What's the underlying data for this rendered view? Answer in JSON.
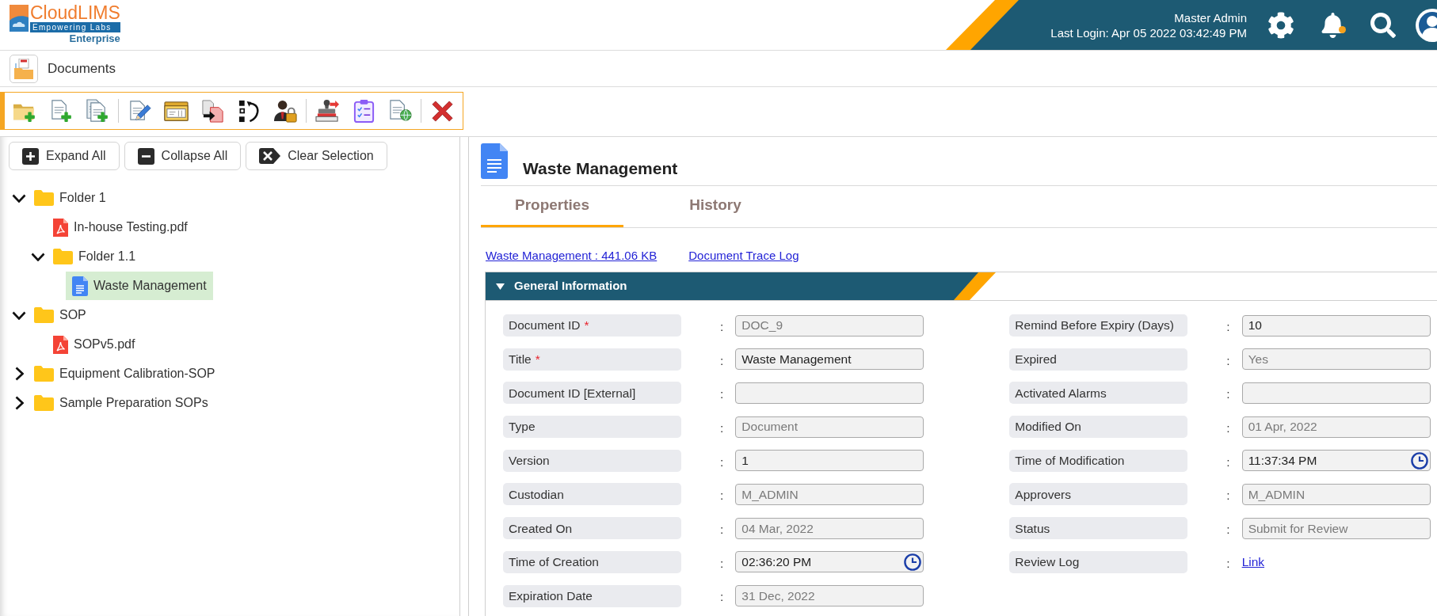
{
  "logo": {
    "name": "CloudLIMS",
    "tagline": "Empowering Labs",
    "edition": "Enterprise"
  },
  "header": {
    "user_name": "Master Admin",
    "last_login": "Last Login: Apr 05 2022 03:42:49 PM",
    "unread_notifications": true
  },
  "page": {
    "title": "Documents"
  },
  "tree_actions": [
    {
      "kind": "expand",
      "label": "Expand All"
    },
    {
      "kind": "collapse",
      "label": "Collapse All"
    },
    {
      "kind": "clear",
      "label": "Clear Selection"
    }
  ],
  "tree": [
    {
      "kind": "folder",
      "label": "Folder 1",
      "expanded": true,
      "selected": false,
      "children": [
        {
          "kind": "pdf",
          "label": "In-house Testing.pdf",
          "selected": false
        },
        {
          "kind": "folder",
          "label": "Folder 1.1",
          "expanded": true,
          "selected": false,
          "children": [
            {
              "kind": "doc",
              "label": "Waste Management",
              "selected": true
            }
          ]
        }
      ]
    },
    {
      "kind": "folder",
      "label": "SOP",
      "expanded": true,
      "selected": false,
      "children": [
        {
          "kind": "pdf",
          "label": "SOPv5.pdf",
          "selected": false
        }
      ]
    },
    {
      "kind": "folder",
      "label": "Equipment Calibration-SOP",
      "expanded": false,
      "selected": false
    },
    {
      "kind": "folder",
      "label": "Sample Preparation SOPs",
      "expanded": false,
      "selected": false
    }
  ],
  "document": {
    "title": "Waste Management"
  },
  "tabs": [
    {
      "label": "Properties",
      "selected": true
    },
    {
      "label": "History",
      "selected": false
    }
  ],
  "links": [
    "Waste Management : 441.06 KB",
    "Document Trace Log"
  ],
  "section": {
    "title": "General Information",
    "expanded": true,
    "columns": [
      [
        {
          "label": "Document ID",
          "required_mark": "*",
          "separator": ":",
          "kind": "text",
          "value": "DOC_9",
          "disabled": true
        },
        {
          "label": "Title",
          "required_mark": "*",
          "separator": ":",
          "kind": "text",
          "value": "Waste Management",
          "disabled": false
        },
        {
          "label": "Document ID [External]",
          "separator": ":",
          "kind": "text",
          "disabled": false
        },
        {
          "label": "Type",
          "separator": ":",
          "kind": "text",
          "value": "Document",
          "disabled": true
        },
        {
          "label": "Version",
          "separator": ":",
          "kind": "text",
          "value": "1",
          "disabled": false
        },
        {
          "label": "Custodian",
          "separator": ":",
          "kind": "text",
          "value": "M_ADMIN",
          "disabled": true
        },
        {
          "label": "Created On",
          "separator": ":",
          "kind": "text",
          "value": "04 Mar, 2022",
          "disabled": true
        },
        {
          "label": "Time of Creation",
          "separator": ":",
          "kind": "time",
          "value": "02:36:20 PM",
          "disabled": false
        },
        {
          "label": "Expiration Date",
          "separator": ":",
          "kind": "text",
          "value": "31 Dec, 2022",
          "disabled": true
        }
      ],
      [
        {
          "label": "Remind Before Expiry (Days)",
          "separator": ":",
          "kind": "text",
          "value": "10",
          "disabled": false
        },
        {
          "label": "Expired",
          "separator": ":",
          "kind": "text",
          "value": "Yes",
          "disabled": true
        },
        {
          "label": "Activated Alarms",
          "separator": ":",
          "kind": "text",
          "disabled": true
        },
        {
          "label": "Modified On",
          "separator": ":",
          "kind": "text",
          "value": "01 Apr, 2022",
          "disabled": true
        },
        {
          "label": "Time of Modification",
          "separator": ":",
          "kind": "time",
          "value": "11:37:34 PM",
          "disabled": false
        },
        {
          "label": "Approvers",
          "separator": ":",
          "kind": "text",
          "value": "M_ADMIN",
          "disabled": true
        },
        {
          "label": "Status",
          "separator": ":",
          "kind": "text",
          "value": "Submit for Review",
          "disabled": true
        },
        {
          "label": "Review Log",
          "separator": ":",
          "kind": "link",
          "value": "Link"
        }
      ]
    ]
  }
}
